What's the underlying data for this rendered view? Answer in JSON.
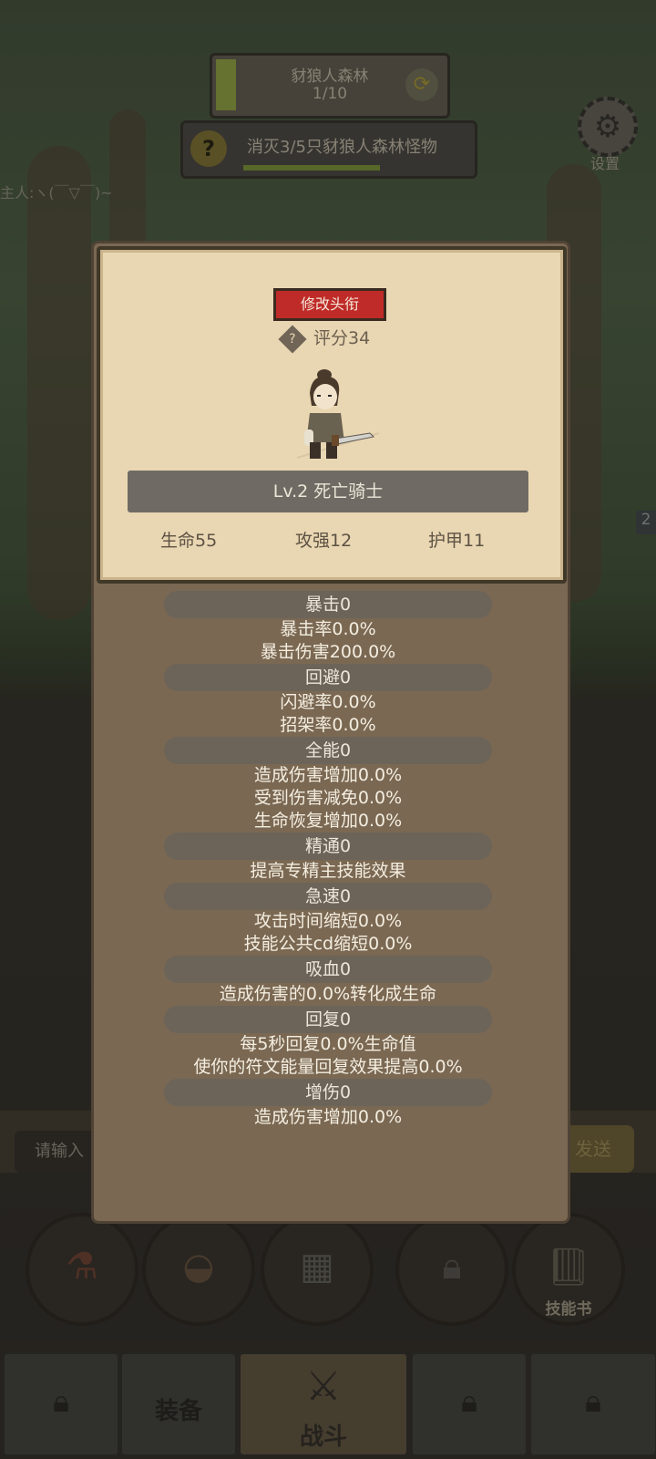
{
  "stage": {
    "name": "豺狼人森林",
    "progress": "1/10",
    "progress_fraction": 0.1
  },
  "quest": {
    "icon": "question-icon",
    "text": "消灭3/5只豺狼人森林怪物",
    "progress_fraction": 0.6
  },
  "settings": {
    "label": "设置"
  },
  "chat": {
    "snippet": "主人:ヽ(￣▽￣)~"
  },
  "side_badge": "2",
  "input": {
    "placeholder": "请输入",
    "send_label": "发送"
  },
  "action_circles": [
    {
      "icon": "potion-icon",
      "label": ""
    },
    {
      "icon": "bread-icon",
      "label": ""
    },
    {
      "icon": "chest-icon",
      "label": ""
    },
    {
      "icon": "lock-icon",
      "label": ""
    },
    {
      "icon": "skill-book-icon",
      "label": "技能书"
    }
  ],
  "tabs": [
    {
      "icon": "lock-icon",
      "label": ""
    },
    {
      "icon": "",
      "label": "装备"
    },
    {
      "icon": "swords-icon",
      "label": "战斗"
    },
    {
      "icon": "lock-icon",
      "label": ""
    },
    {
      "icon": "lock-icon",
      "label": ""
    }
  ],
  "profile": {
    "rename_button": "修改头衔",
    "rating": "评分34",
    "name": "Lv.2 死亡骑士",
    "hp": "生命55",
    "attack": "攻强12",
    "armor": "护甲11"
  },
  "attributes": [
    {
      "header": "暴击0",
      "lines": [
        "暴击率0.0%",
        "暴击伤害200.0%"
      ]
    },
    {
      "header": "回避0",
      "lines": [
        "闪避率0.0%",
        "招架率0.0%"
      ]
    },
    {
      "header": "全能0",
      "lines": [
        "造成伤害增加0.0%",
        "受到伤害减免0.0%",
        "生命恢复增加0.0%"
      ]
    },
    {
      "header": "精通0",
      "lines": [
        "提高专精主技能效果"
      ]
    },
    {
      "header": "急速0",
      "lines": [
        "攻击时间缩短0.0%",
        "技能公共cd缩短0.0%"
      ]
    },
    {
      "header": "吸血0",
      "lines": [
        "造成伤害的0.0%转化成生命"
      ]
    },
    {
      "header": "回复0",
      "lines": [
        "每5秒回复0.0%生命值",
        "使你的符文能量回复效果提高0.0%"
      ]
    },
    {
      "header": "增伤0",
      "lines": [
        "造成伤害增加0.0%"
      ]
    }
  ]
}
